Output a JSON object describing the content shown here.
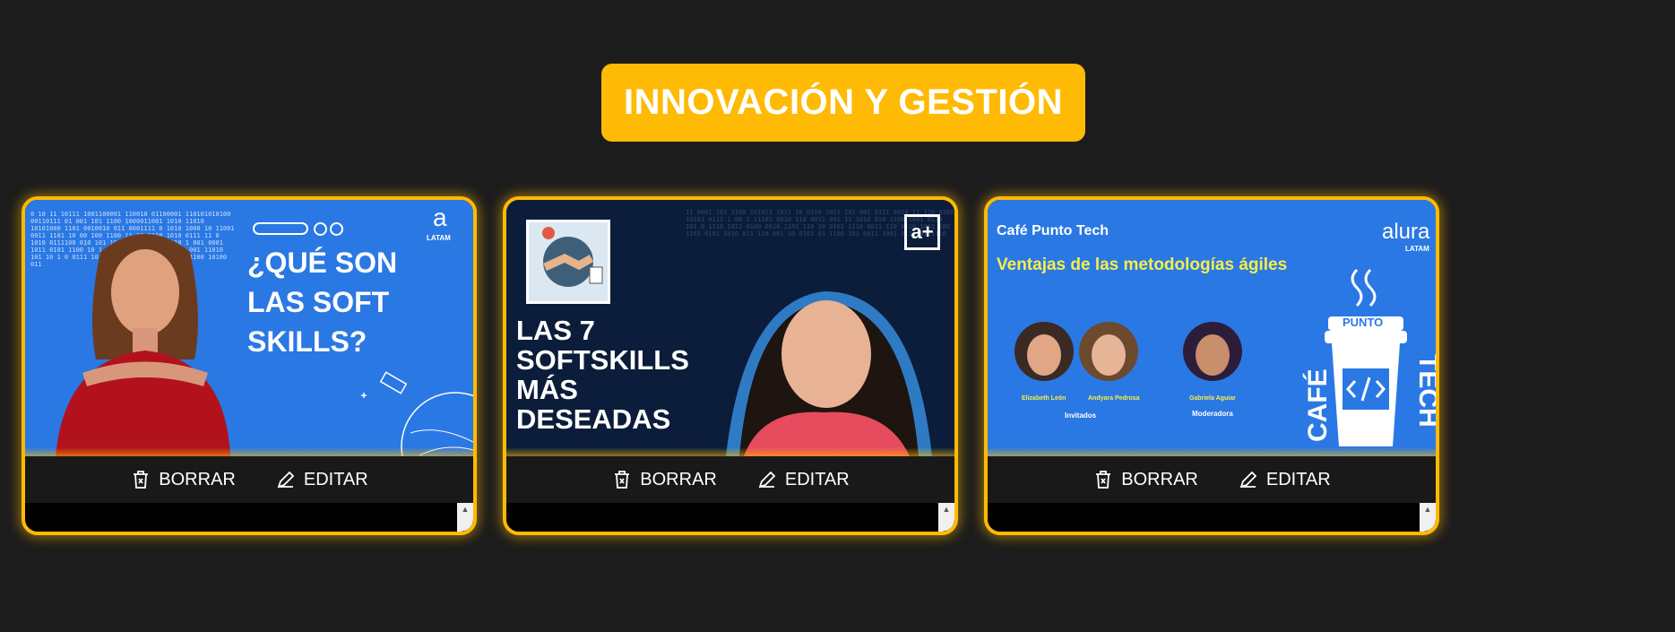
{
  "category": {
    "title": "INNOVACIÓN Y GESTIÓN",
    "color": "#ffba05"
  },
  "actions": {
    "delete_label": "BORRAR",
    "edit_label": "EDITAR"
  },
  "cards": [
    {
      "title_lines": [
        "¿QUÉ SON",
        "LAS SOFT",
        "SKILLS?"
      ],
      "logo": "a",
      "logo_sub": "LATAM",
      "background": "#2a78e4"
    },
    {
      "title_lines": [
        "LAS 7",
        "SOFTSKILLS",
        "MÁS",
        "DESEADAS"
      ],
      "logo": "a+",
      "background": "#0b1d3a"
    },
    {
      "header": "Café Punto Tech",
      "subtitle": "Ventajas de las metodologías ágiles",
      "logo": "alura",
      "logo_sub": "LATAM",
      "people": [
        {
          "name": "Elizabeth León"
        },
        {
          "name": "Andyara Pedrosa"
        },
        {
          "name": "Gabriela Aguiar"
        }
      ],
      "role_guests": "Invitados",
      "role_moderator": "Moderadora",
      "cup_label": "PUNTO",
      "side_left": "CAFÉ",
      "side_right": "TECH",
      "background": "#2a78e4"
    }
  ]
}
